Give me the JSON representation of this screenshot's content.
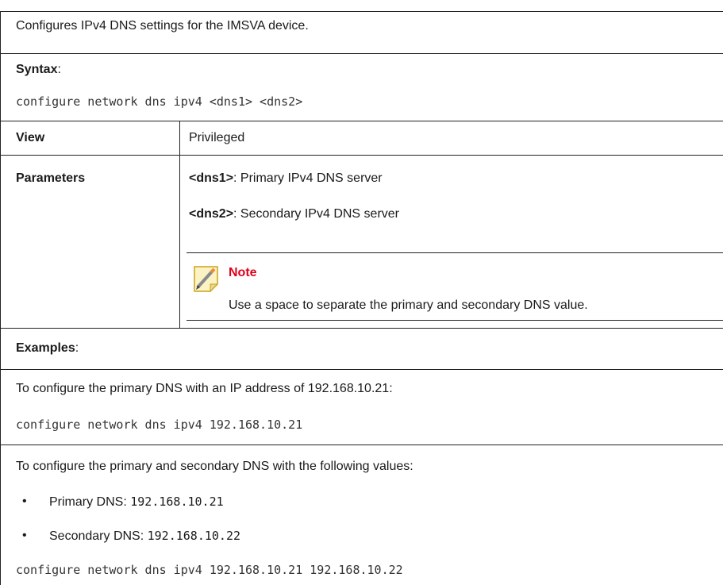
{
  "description": "Configures IPv4 DNS settings for the IMSVA device.",
  "syntax": {
    "label": "Syntax",
    "colon": ":",
    "command": "configure network dns ipv4 <dns1> <dns2>"
  },
  "view": {
    "label": "View",
    "value": "Privileged"
  },
  "parameters": {
    "label": "Parameters",
    "items": [
      {
        "name": "<dns1>",
        "desc": ": Primary IPv4 DNS server"
      },
      {
        "name": "<dns2>",
        "desc": ": Secondary IPv4 DNS server"
      }
    ],
    "note": {
      "title": "Note",
      "text": "Use a space to separate the primary and secondary DNS value.",
      "icon": "note-pencil-icon"
    }
  },
  "examples": {
    "label": "Examples",
    "colon": ":",
    "ex1": {
      "text": "To configure the primary DNS with an IP address of 192.168.10.21:",
      "command": "configure network dns ipv4 192.168.10.21"
    },
    "ex2": {
      "text": "To configure the primary and secondary DNS with the following values:",
      "bullets": [
        {
          "label": "Primary DNS: ",
          "value": "192.168.10.21"
        },
        {
          "label": "Secondary DNS: ",
          "value": "192.168.10.22"
        }
      ],
      "command": "configure network dns ipv4 192.168.10.21 192.168.10.22"
    }
  },
  "colors": {
    "note_title": "#e0001b",
    "rule": "#222222",
    "text": "#1a1a1a"
  }
}
